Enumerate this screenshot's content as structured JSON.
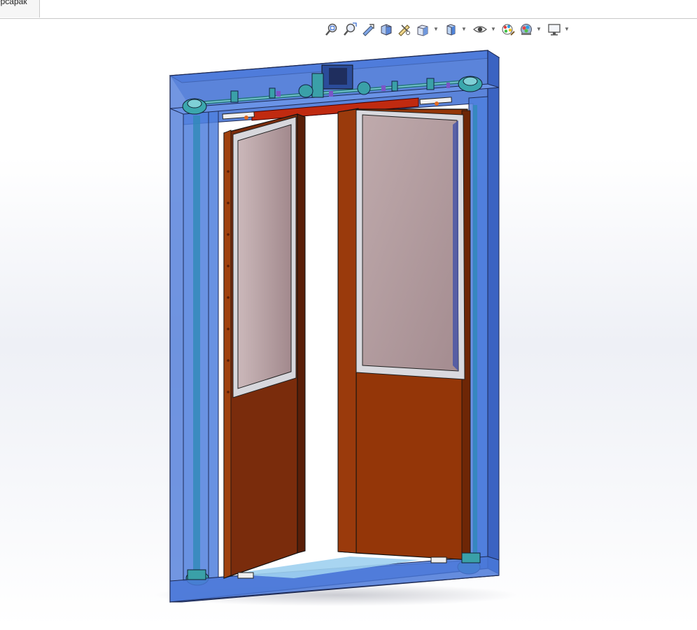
{
  "document_tab": {
    "label": "Эрсарак"
  },
  "heads_up_toolbar": {
    "tools": [
      {
        "icon": "zoom-to-fit-icon"
      },
      {
        "icon": "zoom-to-area-icon"
      },
      {
        "icon": "previous-view-icon"
      },
      {
        "icon": "section-view-icon"
      },
      {
        "icon": "dynamic-annotation-views-icon"
      },
      {
        "icon": "view-orientation-icon",
        "has_dropdown": true
      },
      {
        "icon": "display-style-icon",
        "has_dropdown": true
      },
      {
        "icon": "hide-show-items-icon",
        "has_dropdown": true
      },
      {
        "icon": "edit-appearance-icon"
      },
      {
        "icon": "apply-scene-icon",
        "has_dropdown": true
      },
      {
        "icon": "view-settings-icon",
        "has_dropdown": true
      }
    ]
  },
  "model": {
    "description_colors": {
      "frame": "#4a78d8",
      "door_panel": "#943608",
      "glass": "#b8a3a6",
      "header_beam": "#c02a10",
      "mechanism": "#3aa0a8"
    }
  }
}
